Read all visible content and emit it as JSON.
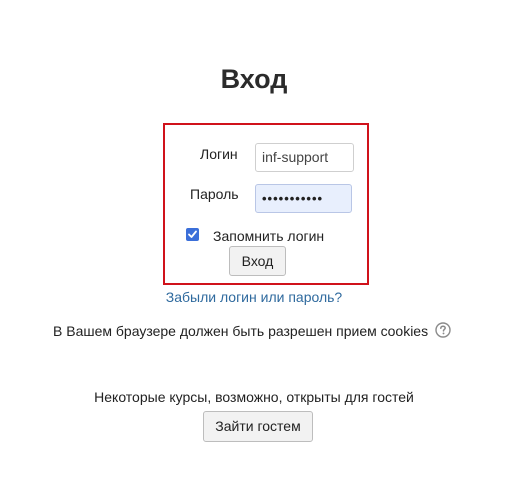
{
  "page": {
    "title": "Вход"
  },
  "form": {
    "login_label": "Логин",
    "login_value": "inf-support",
    "password_label": "Пароль",
    "password_masked": "•••••••••••",
    "remember_label": "Запомнить логин",
    "remember_checked": true,
    "submit_label": "Вход"
  },
  "links": {
    "forgot": "Забыли логин или пароль?"
  },
  "notices": {
    "cookies": "В Вашем браузере должен быть разрешен прием cookies",
    "guest_note": "Некоторые курсы, возможно, открыты для гостей"
  },
  "guest": {
    "button_label": "Зайти гостем"
  },
  "colors": {
    "highlight_border": "#d0121b",
    "link": "#2f6a9e",
    "checkbox": "#3b6fd9"
  },
  "icons": {
    "help": "help-icon",
    "checkmark": "checkmark-icon"
  }
}
